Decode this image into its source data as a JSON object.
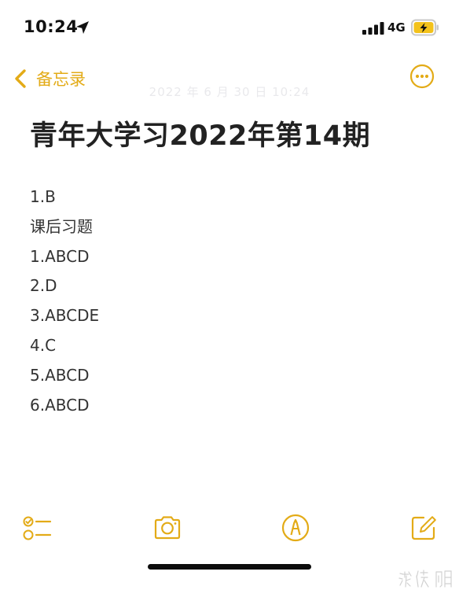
{
  "status_bar": {
    "time": "10:24",
    "network": "4G",
    "icons": [
      "location-arrow-icon",
      "cellular-signal-icon",
      "battery-charging-icon"
    ]
  },
  "nav": {
    "back_label": "备忘录",
    "back_icon": "chevron-left-icon",
    "more_icon": "ellipsis-circle-icon"
  },
  "note": {
    "timestamp": "2022 年 6 月 30 日 10:24",
    "title": "青年大学习2022年第14期",
    "lines": [
      "1.B",
      "课后习题",
      "1.ABCD",
      "2.D",
      "3.ABCDE",
      "4.C",
      "5.ABCD",
      "6.ABCD"
    ]
  },
  "toolbar": {
    "items": [
      "checklist-icon",
      "camera-icon",
      "markup-pen-icon",
      "compose-icon"
    ]
  },
  "watermark": {
    "text": "游侠网"
  },
  "colors": {
    "accent": "#e3ab17",
    "title_text": "#222222",
    "body_text": "#333333",
    "timestamp": "#e9e9ec",
    "home_indicator": "#0c0c0c",
    "background": "#ffffff"
  }
}
